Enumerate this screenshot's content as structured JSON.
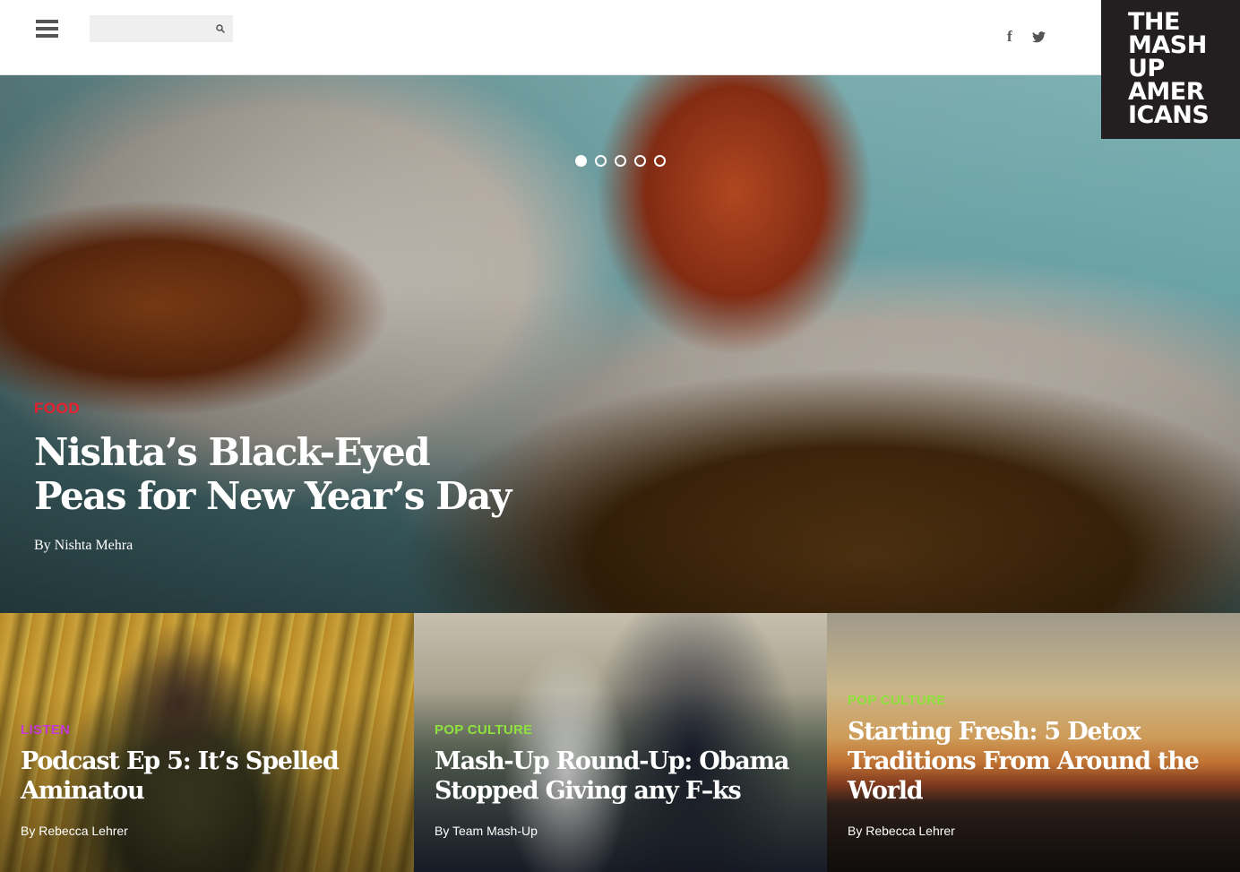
{
  "header": {
    "search_placeholder": "",
    "social": {
      "facebook_glyph": "f",
      "twitter_glyph": "🐦︎"
    },
    "logo_lines": [
      "THE",
      "MASH",
      "UP",
      "AMER",
      "ICANS"
    ]
  },
  "hero": {
    "category": "FOOD",
    "category_color": "#e8202e",
    "title": "Nishta’s Black-Eyed Peas for New Year’s Day",
    "byline": "By Nishta Mehra",
    "carousel": {
      "slides": 5,
      "active": 1
    }
  },
  "cards": [
    {
      "category": "LISTEN",
      "category_color": "#c13ad1",
      "title": "Podcast Ep 5: It’s Spelled Aminatou",
      "byline": "By Rebecca Lehrer"
    },
    {
      "category": "POP CULTURE",
      "category_color": "#8ee23c",
      "title": "Mash-Up Round-Up: Obama Stopped Giving any F–ks",
      "byline": "By Team Mash-Up"
    },
    {
      "category": "POP CULTURE",
      "category_color": "#8ee23c",
      "title": "Starting Fresh: 5 Detox Traditions From Around the World",
      "byline": "By Rebecca Lehrer"
    }
  ],
  "icons": [
    "hamburger-menu-icon",
    "search-icon",
    "facebook-icon",
    "twitter-icon"
  ]
}
